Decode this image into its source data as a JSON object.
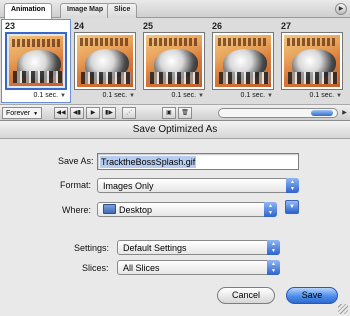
{
  "palette": {
    "tabs": [
      "Animation",
      "Image Map",
      "Slice"
    ],
    "active_tab": 0,
    "frames": [
      {
        "number": "23",
        "delay": "0.1 sec.",
        "selected": true
      },
      {
        "number": "24",
        "delay": "0.1 sec.",
        "selected": false
      },
      {
        "number": "25",
        "delay": "0.1 sec.",
        "selected": false
      },
      {
        "number": "26",
        "delay": "0.1 sec.",
        "selected": false
      },
      {
        "number": "27",
        "delay": "0.1 sec.",
        "selected": false
      }
    ],
    "looping": "Forever"
  },
  "dialog": {
    "title": "Save Optimized As",
    "save_as_label": "Save As:",
    "save_as_value": "TracktheBossSplash.gif",
    "format_label": "Format:",
    "format_value": "Images Only",
    "where_label": "Where:",
    "where_value": "Desktop",
    "settings_label": "Settings:",
    "settings_value": "Default Settings",
    "slices_label": "Slices:",
    "slices_value": "All Slices",
    "cancel_label": "Cancel",
    "save_label": "Save"
  },
  "colors": {
    "accent": "#2d6ad0",
    "selection": "#b7cdf0"
  },
  "icons": [
    "palette-menu-icon",
    "first-frame-icon",
    "previous-frame-icon",
    "play-icon",
    "next-frame-icon",
    "tween-icon",
    "duplicate-frame-icon",
    "trash-icon",
    "folder-icon",
    "expand-icon"
  ]
}
